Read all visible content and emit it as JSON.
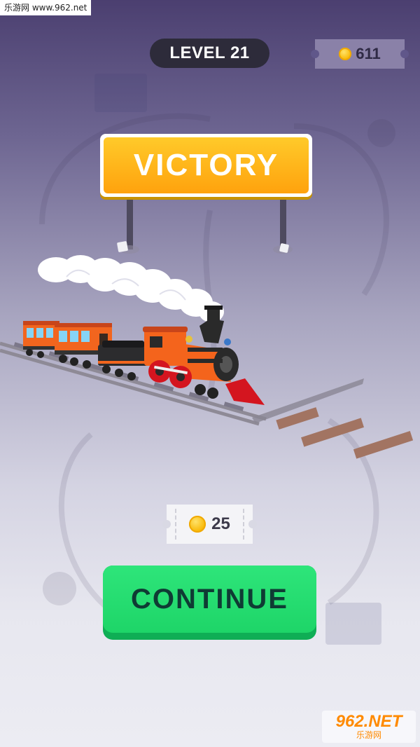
{
  "watermark_top": "乐游网 www.962.net",
  "header": {
    "level_label": "LEVEL 21",
    "coin_balance": "611"
  },
  "victory_sign": {
    "text": "VICTORY"
  },
  "reward": {
    "coins": "25"
  },
  "continue_button": {
    "label": "CONTINUE"
  },
  "watermark_bottom": {
    "brand": "962.NET",
    "sub": "乐游网"
  },
  "colors": {
    "sign": "#ffb515",
    "continue": "#22dc6c",
    "coin": "#f8b600",
    "train_body": "#f4641c"
  },
  "icons": {
    "coin": "coin-icon",
    "train": "steam-train-icon",
    "smoke": "smoke-cloud-icon"
  }
}
